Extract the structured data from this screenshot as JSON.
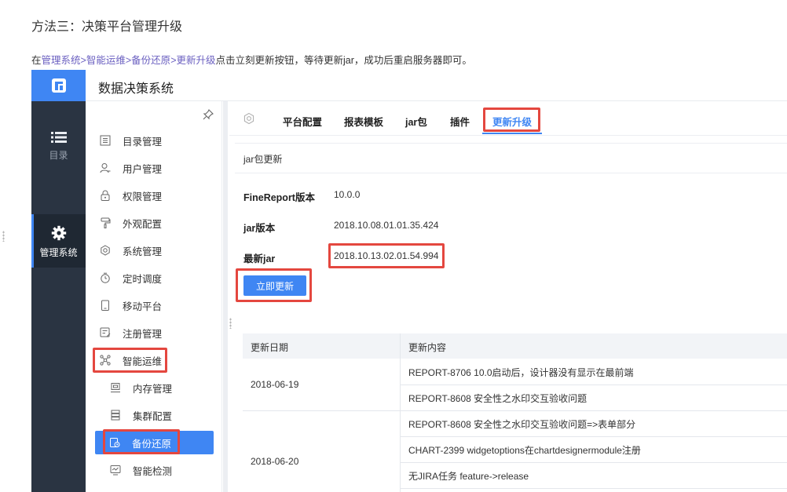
{
  "doc": {
    "heading": "方法三：决策平台管理升级",
    "instruction": {
      "prefix": "在",
      "path1": "管理系统",
      "sep1": ">",
      "path2": "智能运维",
      "sep2": ">",
      "path3": "备份还原",
      "sep3": ">",
      "path4": "更新升级",
      "suffix": "点击立刻更新按钮，等待更新jar，成功后重启服务器即可。"
    }
  },
  "app": {
    "title": "数据决策系统",
    "rail": [
      {
        "label": "目录",
        "icon": "list-icon"
      },
      {
        "label": "管理系统",
        "icon": "gear-icon"
      }
    ],
    "menu": [
      {
        "label": "目录管理",
        "icon": "directory-icon"
      },
      {
        "label": "用户管理",
        "icon": "user-icon"
      },
      {
        "label": "权限管理",
        "icon": "lock-icon"
      },
      {
        "label": "外观配置",
        "icon": "paint-roller-icon"
      },
      {
        "label": "系统管理",
        "icon": "settings-icon"
      },
      {
        "label": "定时调度",
        "icon": "timer-icon"
      },
      {
        "label": "移动平台",
        "icon": "mobile-icon"
      },
      {
        "label": "注册管理",
        "icon": "register-icon"
      },
      {
        "label": "智能运维",
        "icon": "ops-icon"
      },
      {
        "label": "内存管理",
        "icon": "memory-icon"
      },
      {
        "label": "集群配置",
        "icon": "cluster-icon"
      },
      {
        "label": "备份还原",
        "icon": "backup-icon"
      },
      {
        "label": "智能检测",
        "icon": "monitor-icon"
      }
    ],
    "tabs": [
      "平台配置",
      "报表模板",
      "jar包",
      "插件",
      "更新升级"
    ],
    "active_tab": "更新升级",
    "panel": {
      "title": "jar包更新",
      "rows": [
        {
          "label": "FineReport版本",
          "value": "10.0.0"
        },
        {
          "label": "jar版本",
          "value": "2018.10.08.01.01.35.424"
        },
        {
          "label": "最新jar",
          "value": "2018.10.13.02.01.54.994"
        }
      ],
      "update_button": "立即更新"
    },
    "table": {
      "headers": [
        "更新日期",
        "更新内容"
      ],
      "groups": [
        {
          "date": "2018-06-19",
          "items": [
            "REPORT-8706 10.0启动后，设计器没有显示在最前端",
            "REPORT-8608 安全性之水印交互验收问题"
          ]
        },
        {
          "date": "2018-06-20",
          "items": [
            "REPORT-8608 安全性之水印交互验收问题=>表单部分",
            "CHART-2399  widgetoptions在chartdesignermodule注册",
            "无JIRA任务 feature->release"
          ]
        }
      ]
    }
  },
  "colors": {
    "accent": "#3f86f3",
    "rail_bg": "#2a3442",
    "highlight": "#e4473f",
    "link": "#6a5fc0"
  }
}
